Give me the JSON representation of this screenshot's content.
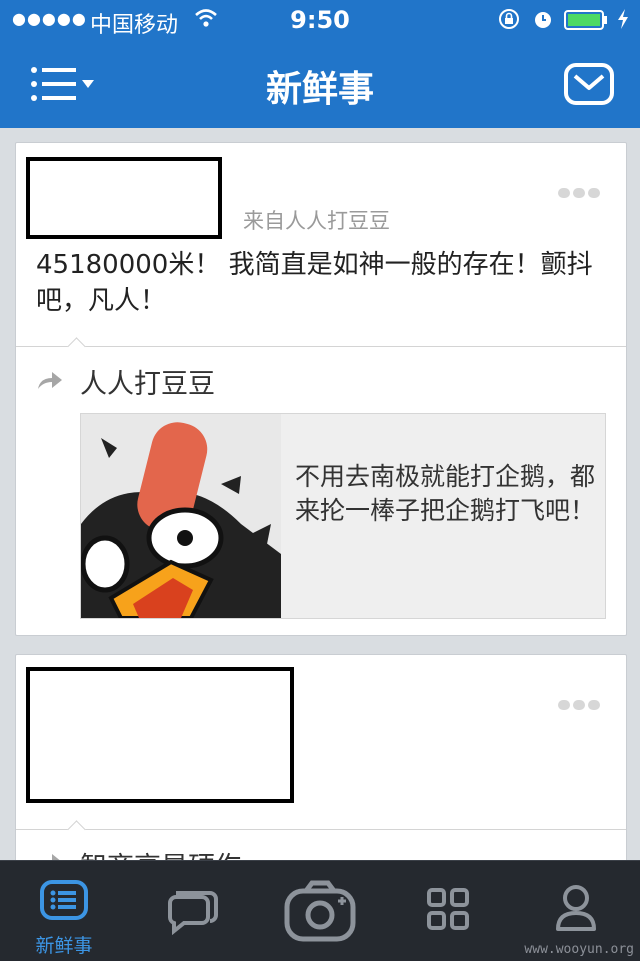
{
  "status_bar": {
    "signal": "●●●●●",
    "carrier": "中国移动",
    "time": "9:50"
  },
  "nav": {
    "title": "新鲜事"
  },
  "feed": [
    {
      "source": "来自人人打豆豆",
      "text": "45180000米！ 我简直是如神一般的存在！颤抖吧，凡人！",
      "shared_app": "人人打豆豆",
      "shared_desc": "不用去南极就能打企鹅，都来抡一棒子把企鹅打飞吧！"
    },
    {
      "shared_app": "智商高是硬伤"
    }
  ],
  "tab_bar": {
    "active_label": "新鲜事",
    "tabs": [
      "feed-icon",
      "chat-icon",
      "camera-icon",
      "apps-icon",
      "profile-icon"
    ]
  },
  "watermark": "www.wooyun.org",
  "colors": {
    "brand_blue": "#2175c9",
    "tab_active": "#3c95e4",
    "tab_bg": "#25292f"
  }
}
